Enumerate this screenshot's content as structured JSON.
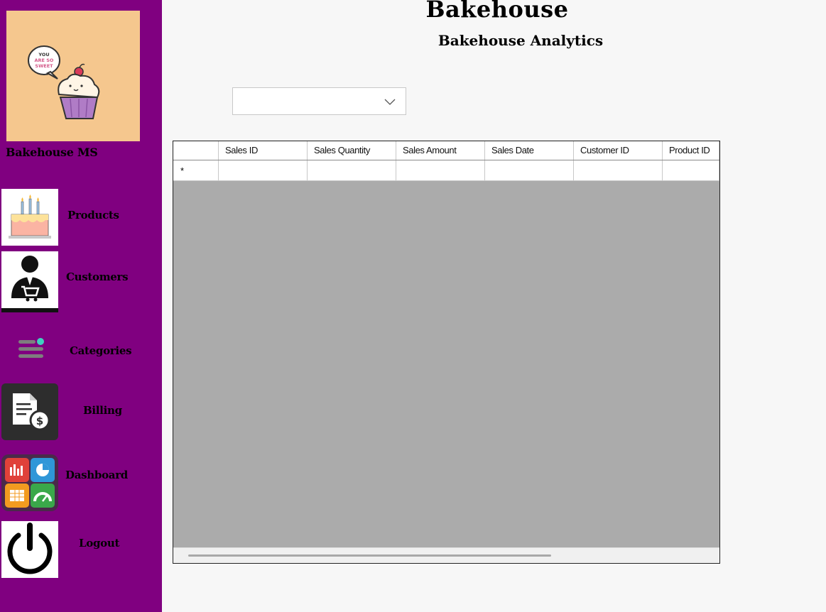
{
  "app": {
    "title": "Bakehouse",
    "subtitle": "Bakehouse Analytics",
    "brand": "Bakehouse MS",
    "logo_bubble_lines": [
      "YOU",
      "ARE SO",
      "SWEET"
    ]
  },
  "sidebar": {
    "items": [
      {
        "label": "Products",
        "icon": "cake-icon"
      },
      {
        "label": "Customers",
        "icon": "customer-cart-icon"
      },
      {
        "label": "Categories",
        "icon": "categories-icon"
      },
      {
        "label": "Billing",
        "icon": "billing-invoice-icon"
      },
      {
        "label": "Dashboard",
        "icon": "dashboard-icon"
      },
      {
        "label": "Logout",
        "icon": "power-icon"
      }
    ]
  },
  "filter": {
    "selected": ""
  },
  "grid": {
    "columns": [
      "Sales ID",
      "Sales Quantity",
      "Sales Amount",
      "Sales Date",
      "Customer ID",
      "Product ID"
    ],
    "new_row_marker": "*"
  },
  "colors": {
    "sidebar": "#800080",
    "logo_bg": "#f5c78e",
    "grid_bg": "#ababab",
    "page_bg": "#f7f7f7"
  }
}
